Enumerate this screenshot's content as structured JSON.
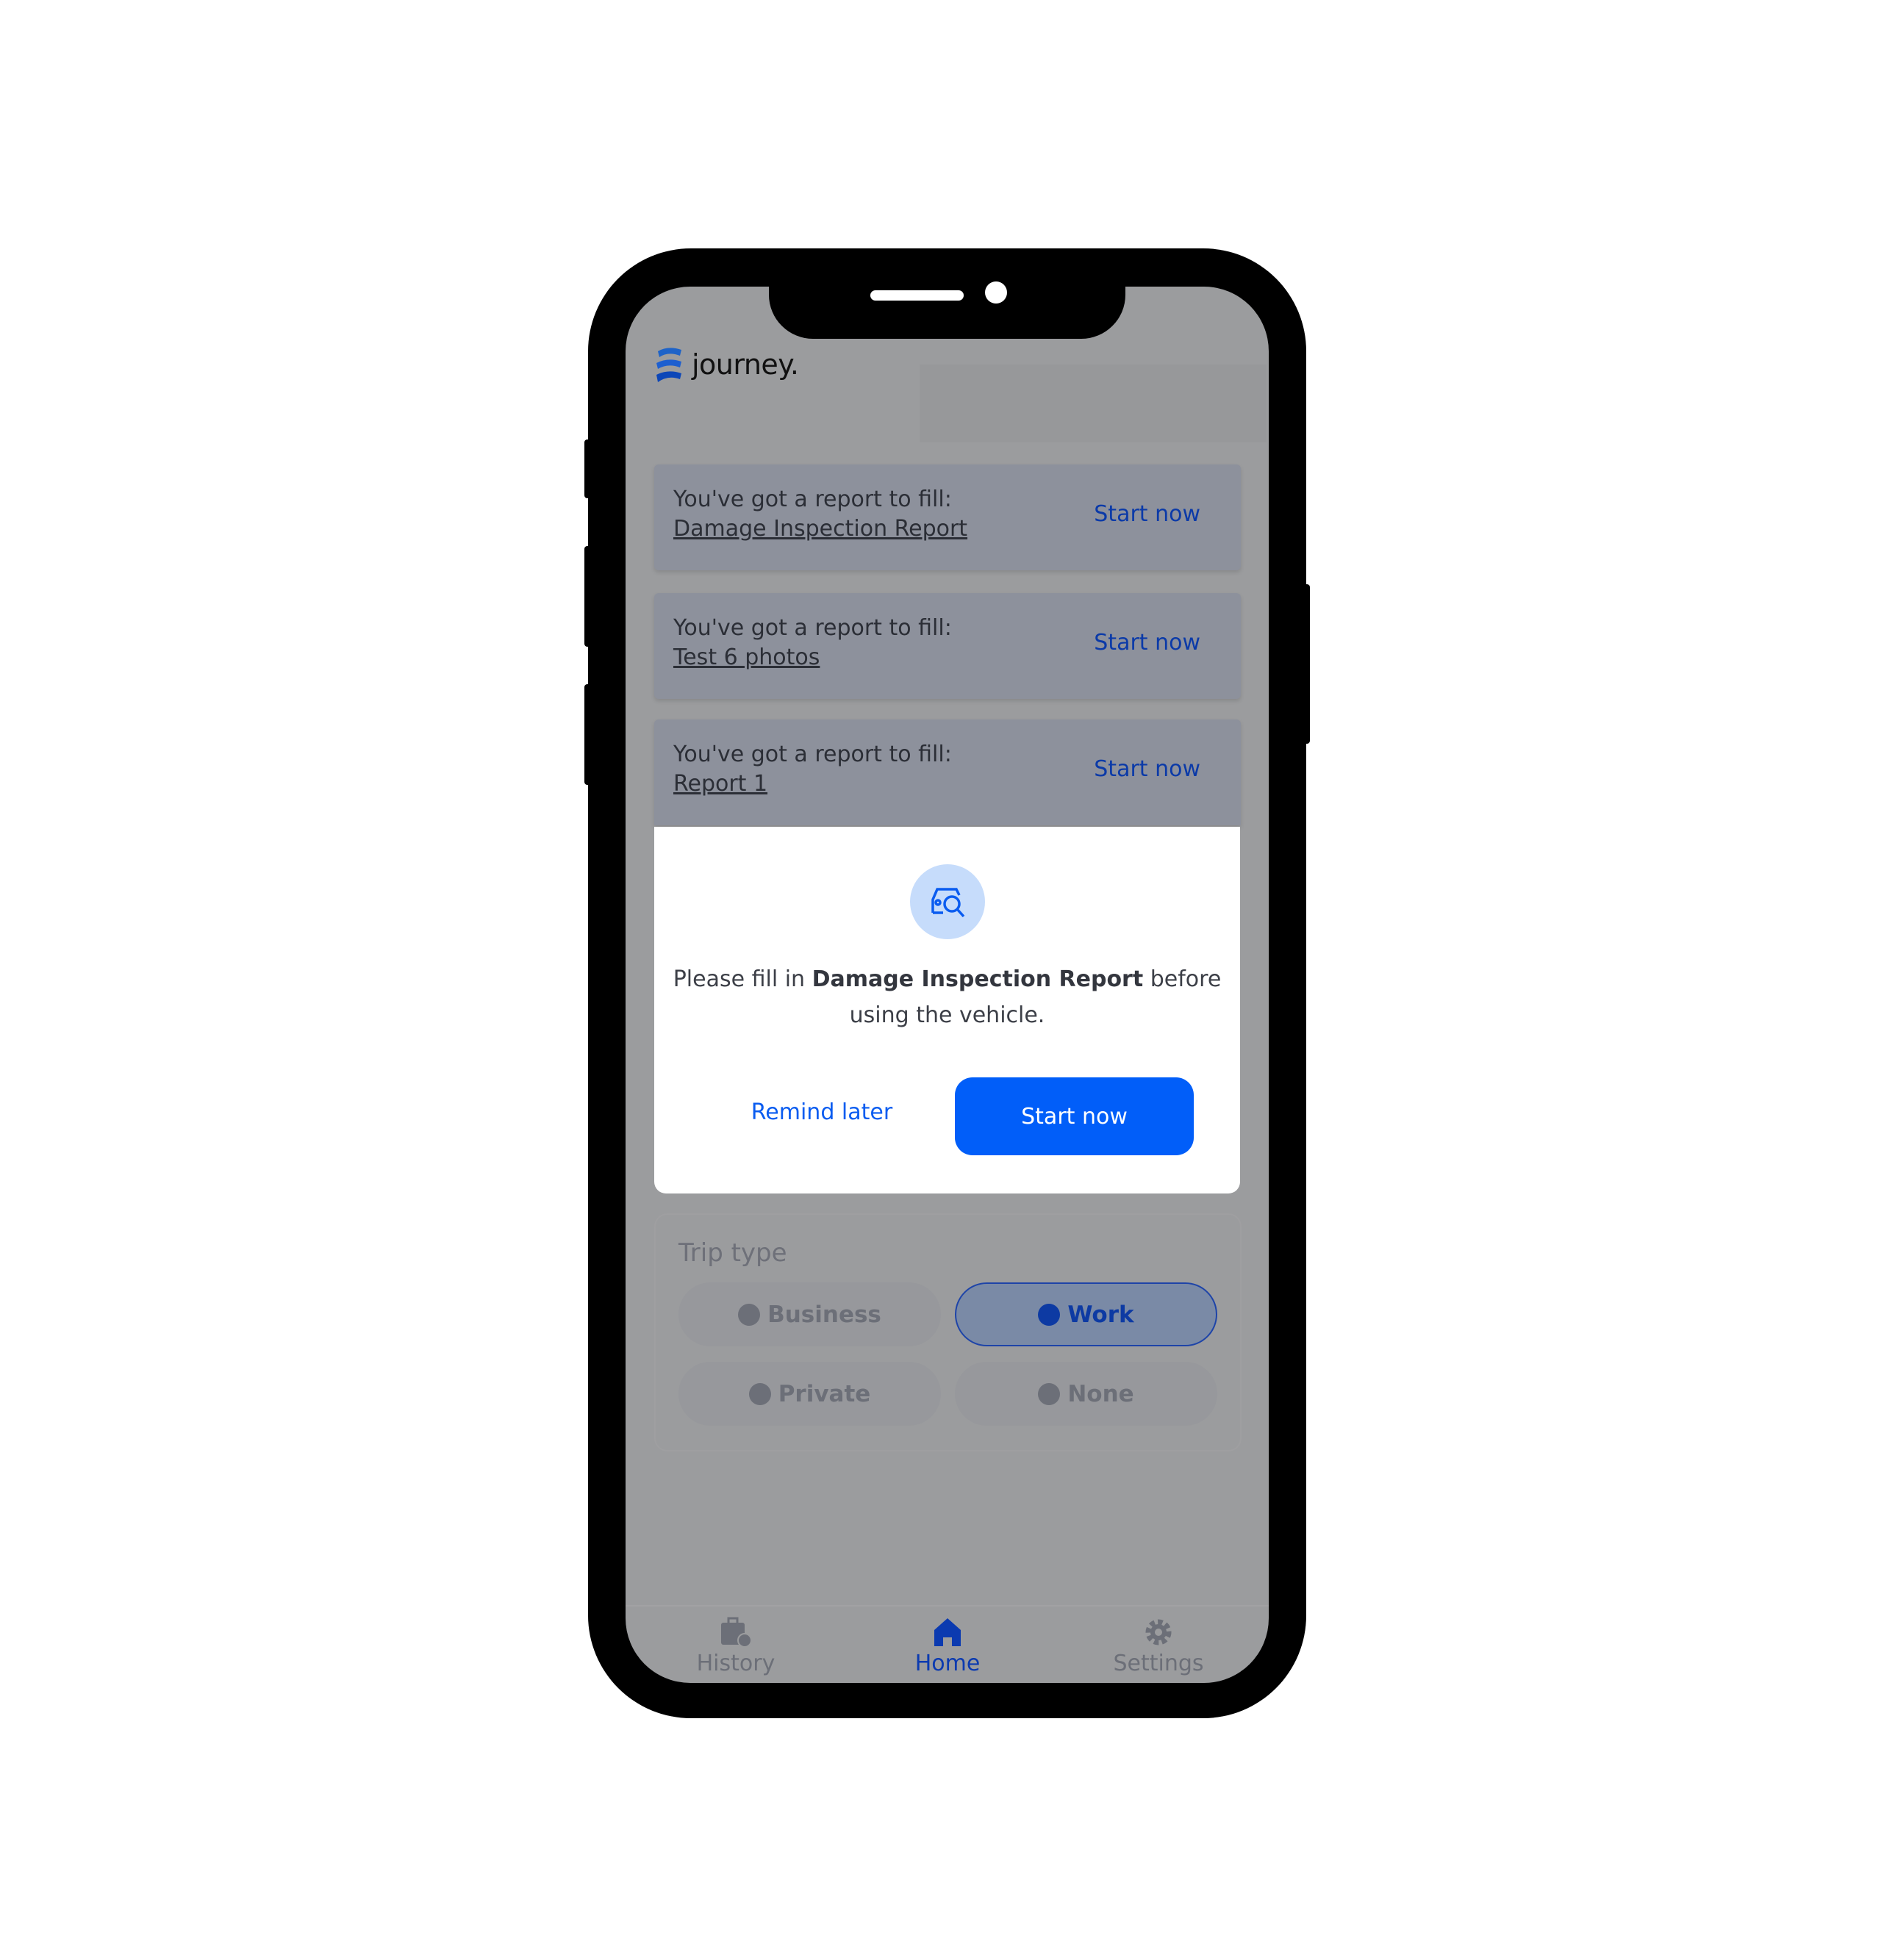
{
  "app": {
    "logo_text": "journey."
  },
  "report_cards": [
    {
      "prompt": "You've got a report to fill:",
      "report_name": "Damage Inspection Report",
      "action": "Start now"
    },
    {
      "prompt": "You've got a report to fill:",
      "report_name": "Test 6 photos",
      "action": "Start now"
    },
    {
      "prompt": "You've got a report to fill:",
      "report_name": "Report 1",
      "action": "Start now"
    }
  ],
  "modal": {
    "icon": "car-inspection-icon",
    "message_pre": "Please fill in ",
    "message_bold": "Damage Inspection Report",
    "message_post": " before using the vehicle.",
    "remind_label": "Remind later",
    "start_label": "Start now"
  },
  "trip_type": {
    "title": "Trip type",
    "options": [
      {
        "label": "Business",
        "icon": "briefcase-icon",
        "selected": false
      },
      {
        "label": "Work",
        "icon": "building-icon",
        "selected": true
      },
      {
        "label": "Private",
        "icon": "lock-icon",
        "selected": false
      },
      {
        "label": "None",
        "icon": "block-icon",
        "selected": false
      }
    ]
  },
  "bottom_nav": [
    {
      "label": "History",
      "icon": "history-icon",
      "active": false
    },
    {
      "label": "Home",
      "icon": "home-icon",
      "active": true
    },
    {
      "label": "Settings",
      "icon": "gear-icon",
      "active": false
    }
  ],
  "colors": {
    "accent": "#015ef9",
    "overlay": "#9b9c9e",
    "active_nav": "#0b3ab0"
  }
}
